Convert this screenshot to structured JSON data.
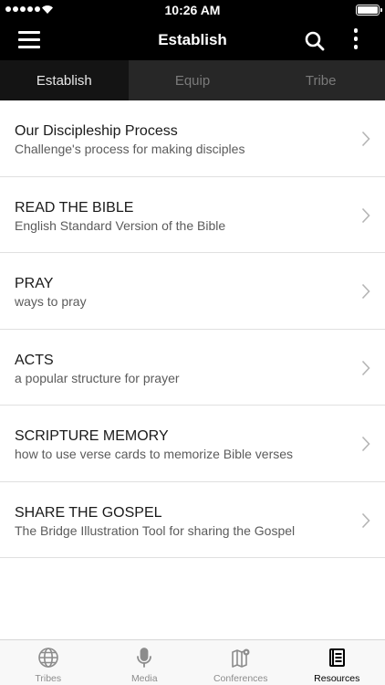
{
  "status_bar": {
    "time": "10:26 AM"
  },
  "nav": {
    "title": "Establish",
    "menu_icon": "hamburger-menu-icon",
    "search_icon": "search-icon",
    "more_icon": "more-vertical-icon"
  },
  "tabs": [
    {
      "label": "Establish",
      "active": true
    },
    {
      "label": "Equip",
      "active": false
    },
    {
      "label": "Tribe",
      "active": false
    }
  ],
  "items": [
    {
      "title": "Our Discipleship Process",
      "subtitle": "Challenge's process for making disciples"
    },
    {
      "title": "READ THE BIBLE",
      "subtitle": "English Standard Version of the Bible"
    },
    {
      "title": "PRAY",
      "subtitle": "ways to pray"
    },
    {
      "title": "ACTS",
      "subtitle": "a popular structure for prayer"
    },
    {
      "title": "SCRIPTURE MEMORY",
      "subtitle": "how to use verse cards to memorize Bible verses"
    },
    {
      "title": "SHARE THE GOSPEL",
      "subtitle": "The Bridge Illustration Tool for sharing the Gospel"
    }
  ],
  "tab_bar": [
    {
      "label": "Tribes",
      "icon": "globe-icon",
      "active": false
    },
    {
      "label": "Media",
      "icon": "microphone-icon",
      "active": false
    },
    {
      "label": "Conferences",
      "icon": "map-pin-icon",
      "active": false
    },
    {
      "label": "Resources",
      "icon": "book-icon",
      "active": true
    }
  ],
  "colors": {
    "bar": "#000000",
    "tab_strip": "#272727",
    "tab_active": "#141414",
    "divider": "#e0e0e0"
  }
}
